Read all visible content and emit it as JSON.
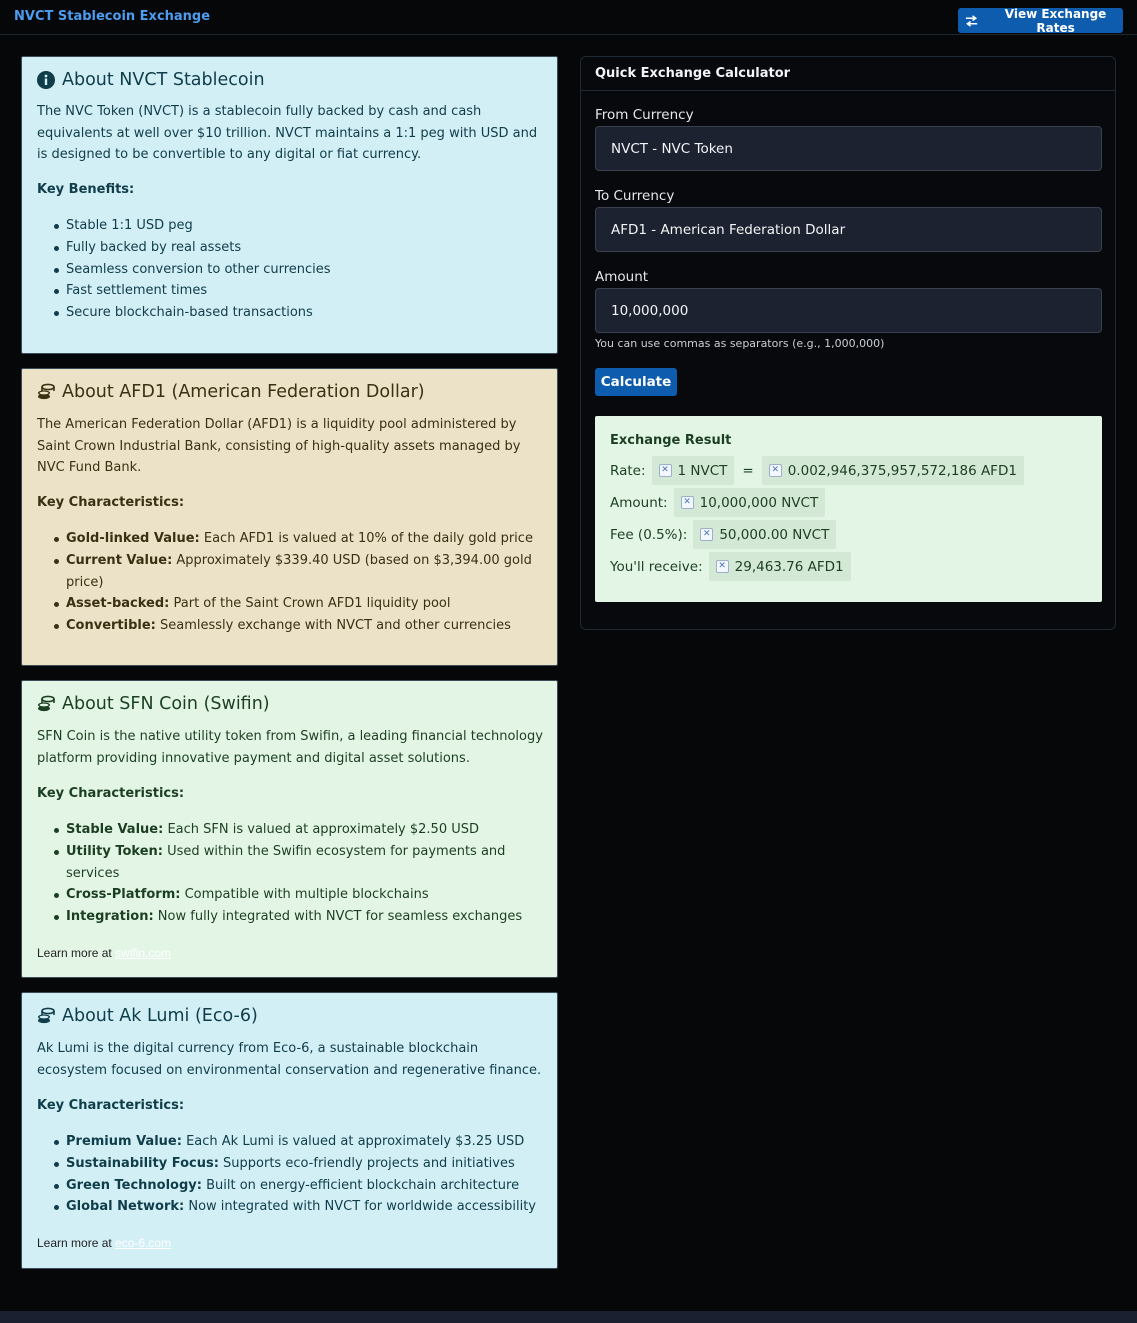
{
  "header": {
    "title": "NVCT Stablecoin Exchange",
    "rates_button": "View Exchange Rates"
  },
  "cards": [
    {
      "icon": "info-circle-icon",
      "title": "About NVCT Stablecoin",
      "description": "The NVC Token (NVCT) is a stablecoin fully backed by cash and cash equivalents at well over $10 trillion. NVCT maintains a 1:1 peg with USD and is designed to be convertible to any digital or fiat currency.",
      "subheading": "Key Benefits:",
      "items": [
        {
          "bold": "",
          "text": "Stable 1:1 USD peg"
        },
        {
          "bold": "",
          "text": "Fully backed by real assets"
        },
        {
          "bold": "",
          "text": "Seamless conversion to other currencies"
        },
        {
          "bold": "",
          "text": "Fast settlement times"
        },
        {
          "bold": "",
          "text": "Secure blockchain-based transactions"
        }
      ]
    },
    {
      "icon": "coins-icon",
      "title": "About AFD1 (American Federation Dollar)",
      "description": "The American Federation Dollar (AFD1) is a liquidity pool administered by Saint Crown Industrial Bank, consisting of high-quality assets managed by NVC Fund Bank.",
      "subheading": "Key Characteristics:",
      "items": [
        {
          "bold": "Gold-linked Value:",
          "text": " Each AFD1 is valued at 10% of the daily gold price"
        },
        {
          "bold": "Current Value:",
          "text": " Approximately $339.40 USD (based on $3,394.00 gold price)"
        },
        {
          "bold": "Asset-backed:",
          "text": " Part of the Saint Crown AFD1 liquidity pool"
        },
        {
          "bold": "Convertible:",
          "text": " Seamlessly exchange with NVCT and other currencies"
        }
      ]
    },
    {
      "icon": "coins-icon",
      "title": "About SFN Coin (Swifin)",
      "description": "SFN Coin is the native utility token from Swifin, a leading financial technology platform providing innovative payment and digital asset solutions.",
      "subheading": "Key Characteristics:",
      "items": [
        {
          "bold": "Stable Value:",
          "text": " Each SFN is valued at approximately $2.50 USD"
        },
        {
          "bold": "Utility Token:",
          "text": " Used within the Swifin ecosystem for payments and services"
        },
        {
          "bold": "Cross-Platform:",
          "text": " Compatible with multiple blockchains"
        },
        {
          "bold": "Integration:",
          "text": " Now fully integrated with NVCT for seamless exchanges"
        }
      ],
      "learn_prefix": "Learn more at ",
      "learn_link": "swifin.com"
    },
    {
      "icon": "coins-icon",
      "title": "About Ak Lumi (Eco-6)",
      "description": "Ak Lumi is the digital currency from Eco-6, a sustainable blockchain ecosystem focused on environmental conservation and regenerative finance.",
      "subheading": "Key Characteristics:",
      "items": [
        {
          "bold": "Premium Value:",
          "text": " Each Ak Lumi is valued at approximately $3.25 USD"
        },
        {
          "bold": "Sustainability Focus:",
          "text": " Supports eco-friendly projects and initiatives"
        },
        {
          "bold": "Green Technology:",
          "text": " Built on energy-efficient blockchain architecture"
        },
        {
          "bold": "Global Network:",
          "text": " Now integrated with NVCT for worldwide accessibility"
        }
      ],
      "learn_prefix": "Learn more at ",
      "learn_link": "eco-6.com"
    }
  ],
  "calculator": {
    "title": "Quick Exchange Calculator",
    "from_label": "From Currency",
    "from_value": "NVCT - NVC Token",
    "to_label": "To Currency",
    "to_value": "AFD1 - American Federation Dollar",
    "amount_label": "Amount",
    "amount_value": "10,000,000",
    "hint": "You can use commas as separators (e.g., 1,000,000)",
    "button": "Calculate",
    "result": {
      "title": "Exchange Result",
      "rate_label": "Rate:",
      "rate_from": "1 NVCT",
      "rate_eq": "=",
      "rate_to": "0.002,946,375,957,572,186 AFD1",
      "amount_label": "Amount:",
      "amount": "10,000,000 NVCT",
      "fee_label": "Fee (0.5%):",
      "fee": "50,000.00 NVCT",
      "receive_label": "You'll receive:",
      "receive": "29,463.76 AFD1"
    }
  },
  "colors": {
    "brand": "#4d9cf0",
    "button": "#0d5cad",
    "card_blue": "#d3eff6",
    "card_tan": "#ece2c7",
    "card_green": "#e3f6e6"
  }
}
